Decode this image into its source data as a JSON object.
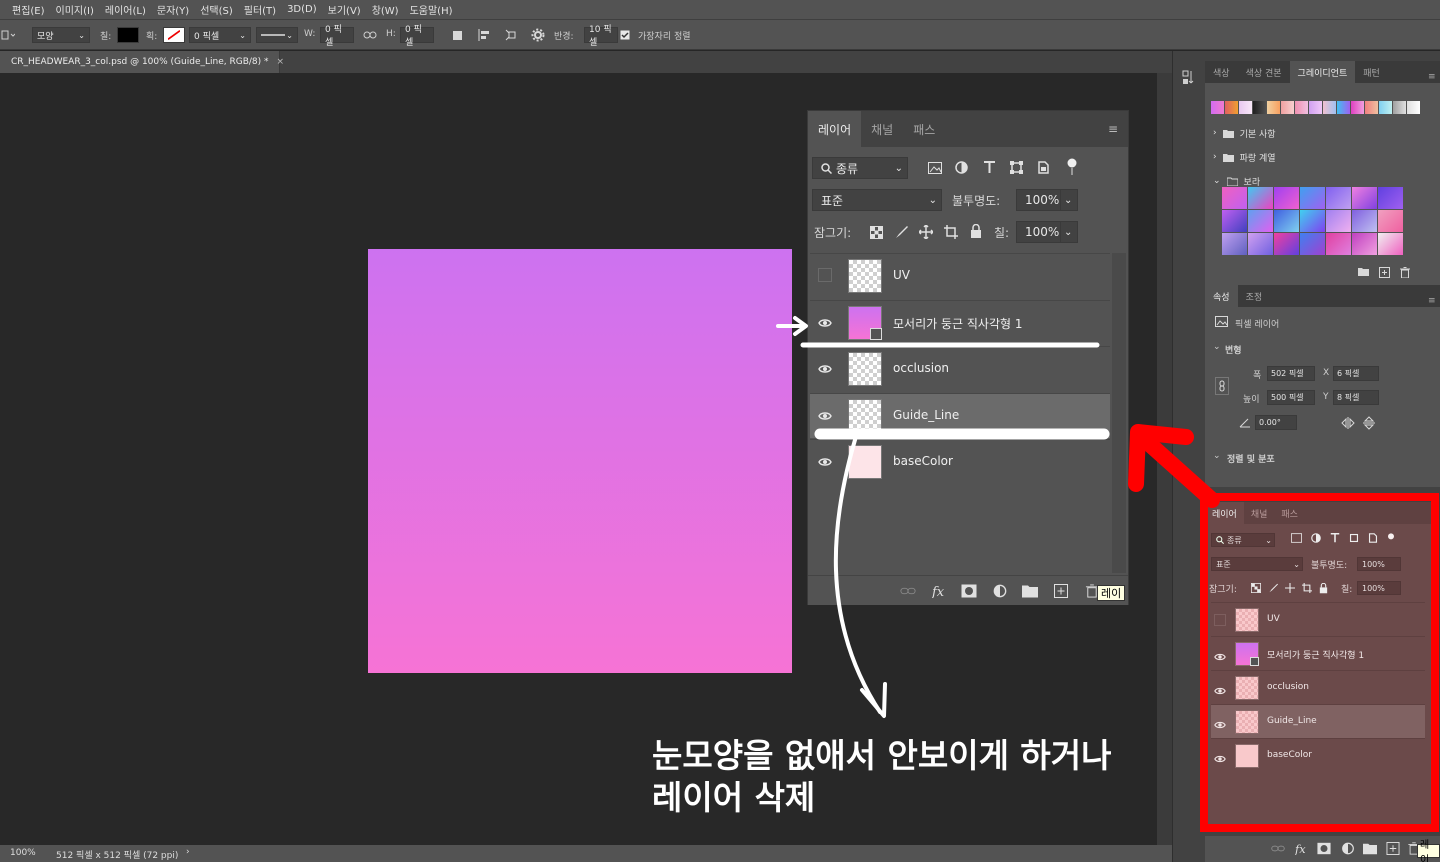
{
  "menu": [
    "편집(E)",
    "이미지(I)",
    "레이어(L)",
    "문자(Y)",
    "선택(S)",
    "필터(T)",
    "3D(D)",
    "보기(V)",
    "창(W)",
    "도움말(H)"
  ],
  "options": {
    "shape_mode": "모양",
    "fill_label": "칠:",
    "stroke_label": "획:",
    "stroke_width": "0 픽셀",
    "w_label": "W:",
    "w_value": "0 픽셀",
    "h_label": "H:",
    "h_value": "0 픽셀",
    "radius_label": "반경:",
    "radius_value": "10 픽셀",
    "align_edges_label": "가장자리 정렬"
  },
  "document": {
    "tab_title": "CR_HEADWEAR_3_col.psd @ 100% (Guide_Line, RGB/8) *",
    "tab_close": "×"
  },
  "status": {
    "zoom": "100%",
    "dims": "512 픽셀 x 512 픽셀 (72 ppi)",
    "arrow": "›"
  },
  "gradient_panel": {
    "tabs": [
      "색상",
      "색상 견본",
      "그레이디언트",
      "패턴"
    ],
    "active_tab": 2,
    "folders": [
      "기본 사항",
      "파랑 계열",
      "보라"
    ]
  },
  "properties": {
    "tabs": [
      "속성",
      "조정"
    ],
    "layer_type": "픽셀 레이어",
    "section_transform": "변형",
    "width_label": "폭",
    "width_value": "502 픽셀",
    "x_label": "X",
    "x_value": "6 픽셀",
    "height_label": "높이",
    "height_value": "500 픽셀",
    "y_label": "Y",
    "y_value": "8 픽셀",
    "angle_value": "0.00°",
    "section_align": "정렬 및 분포"
  },
  "layers_panel": {
    "tabs": [
      "레이어",
      "채널",
      "패스"
    ],
    "kind_label": "종류",
    "blend_mode": "표준",
    "opacity_label": "불투명도:",
    "opacity_value": "100%",
    "lock_label": "잠그기:",
    "fill_label": "칠:",
    "fill_value": "100%",
    "tooltip": "레이",
    "layers": [
      {
        "name": "UV",
        "visible": false,
        "selected": false,
        "thumb": "checker"
      },
      {
        "name": "모서리가 둥근 직사각형 1",
        "visible": true,
        "selected": false,
        "thumb": "pink"
      },
      {
        "name": "occlusion",
        "visible": true,
        "selected": false,
        "thumb": "checker"
      },
      {
        "name": "Guide_Line",
        "visible": true,
        "selected": true,
        "thumb": "checker"
      },
      {
        "name": "baseColor",
        "visible": true,
        "selected": false,
        "thumb": "light"
      }
    ]
  },
  "layers_panel_small": {
    "tooltip": "레이"
  },
  "annotation": {
    "line1": "눈모양을 없애서 안보이게 하거나",
    "line2": "레이어 삭제"
  },
  "colors": {
    "artwork_top": "#cd72f0",
    "artwork_bottom": "#f673d5",
    "highlight_frame": "#ff0000",
    "annotation_text": "#ffffff"
  }
}
